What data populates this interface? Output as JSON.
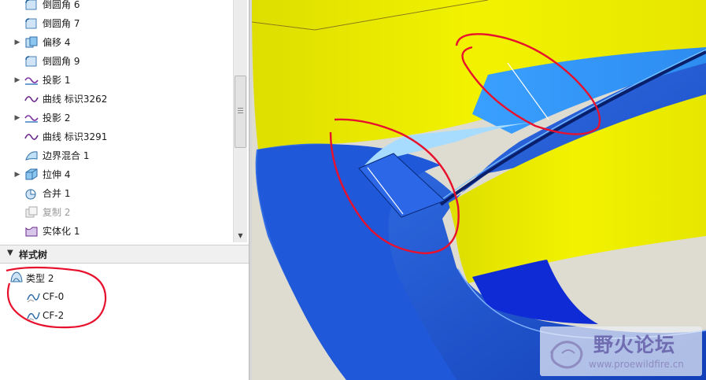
{
  "model_tree": {
    "items": [
      {
        "label": "倒圆角 6",
        "icon": "round-icon",
        "expander": ""
      },
      {
        "label": "倒圆角 7",
        "icon": "round-icon",
        "expander": ""
      },
      {
        "label": "偏移 4",
        "icon": "offset-icon",
        "expander": "▶"
      },
      {
        "label": "倒圆角 9",
        "icon": "round-icon",
        "expander": ""
      },
      {
        "label": "投影 1",
        "icon": "projection-icon",
        "expander": "▶"
      },
      {
        "label": "曲线 标识3262",
        "icon": "curve-icon",
        "expander": ""
      },
      {
        "label": "投影 2",
        "icon": "projection-icon",
        "expander": "▶"
      },
      {
        "label": "曲线 标识3291",
        "icon": "curve-icon",
        "expander": ""
      },
      {
        "label": "边界混合 1",
        "icon": "boundary-blend-icon",
        "expander": ""
      },
      {
        "label": "拉伸 4",
        "icon": "extrude-icon",
        "expander": "▶"
      },
      {
        "label": "合并 1",
        "icon": "merge-icon",
        "expander": ""
      },
      {
        "label": "复制 2",
        "icon": "copy-icon",
        "expander": "",
        "disabled": true
      },
      {
        "label": "实体化 1",
        "icon": "solidify-icon",
        "expander": ""
      }
    ]
  },
  "style_tree": {
    "title": "样式树",
    "collapse_glyph": "▼",
    "root": {
      "label": "类型 2",
      "icon": "style-type-icon"
    },
    "children": [
      {
        "label": "CF-0",
        "icon": "style-curve-icon"
      },
      {
        "label": "CF-2",
        "icon": "style-curve-icon"
      }
    ]
  },
  "scrollbar": {
    "down_glyph": "▼"
  },
  "watermark": {
    "brand": "野火论坛",
    "url": "www.proewildfire.cn"
  },
  "colors": {
    "surface_yellow": "#e8e600",
    "surface_blue": "#2a5fdc",
    "annotation_red": "#e8112d",
    "background": "#dedbd1"
  }
}
